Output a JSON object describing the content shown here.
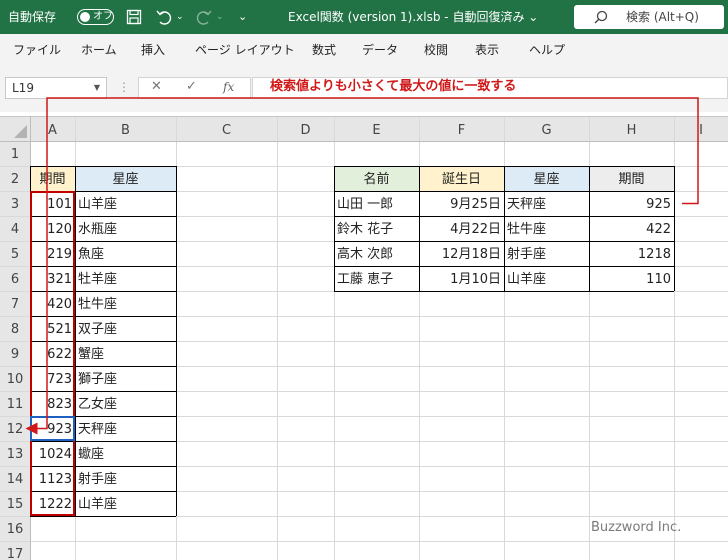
{
  "title_bar": {
    "autosave_label": "自動保存",
    "autosave_state": "オフ",
    "file_title": "Excel関数 (version 1).xlsb  -  自動回復済み  ⌄",
    "search_label": "検索 (Alt+Q)",
    "accent_color": "#217346"
  },
  "menu": [
    "ファイル",
    "ホーム",
    "挿入",
    "ページ レイアウト",
    "数式",
    "データ",
    "校閲",
    "表示",
    "ヘルプ"
  ],
  "formula_bar": {
    "name_box": "L19",
    "cancel_glyph": "✕",
    "enter_glyph": "✓",
    "fx_glyph": "fx",
    "content": ""
  },
  "annotation": "検索値よりも小さくて最大の値に一致する",
  "columns": [
    "A",
    "B",
    "C",
    "D",
    "E",
    "F",
    "G",
    "H",
    "I"
  ],
  "rows": [
    "1",
    "2",
    "3",
    "4",
    "5",
    "6",
    "7",
    "8",
    "9",
    "10",
    "11",
    "12",
    "13",
    "14",
    "15",
    "16",
    "17"
  ],
  "table_left": {
    "headers": [
      "期間",
      "星座"
    ],
    "rows": [
      [
        "101",
        "山羊座"
      ],
      [
        "120",
        "水瓶座"
      ],
      [
        "219",
        "魚座"
      ],
      [
        "321",
        "牡羊座"
      ],
      [
        "420",
        "牡牛座"
      ],
      [
        "521",
        "双子座"
      ],
      [
        "622",
        "蟹座"
      ],
      [
        "723",
        "獅子座"
      ],
      [
        "823",
        "乙女座"
      ],
      [
        "923",
        "天秤座"
      ],
      [
        "1024",
        "蠍座"
      ],
      [
        "1123",
        "射手座"
      ],
      [
        "1222",
        "山羊座"
      ]
    ]
  },
  "table_right": {
    "headers": [
      "名前",
      "誕生日",
      "星座",
      "期間"
    ],
    "rows": [
      [
        "山田 一郎",
        "9月25日",
        "天秤座",
        "925"
      ],
      [
        "鈴木 花子",
        "4月22日",
        "牡牛座",
        "422"
      ],
      [
        "高木 次郎",
        "12月18日",
        "射手座",
        "1218"
      ],
      [
        "工藤 恵子",
        "1月10日",
        "山羊座",
        "110"
      ]
    ]
  },
  "watermark": "Buzzword Inc.",
  "colors": {
    "header_yellow": "#fff2cc",
    "header_blue": "#ddebf7",
    "header_green": "#e2efda",
    "highlight_red": "#c00000",
    "arrow_red": "#d01818"
  }
}
